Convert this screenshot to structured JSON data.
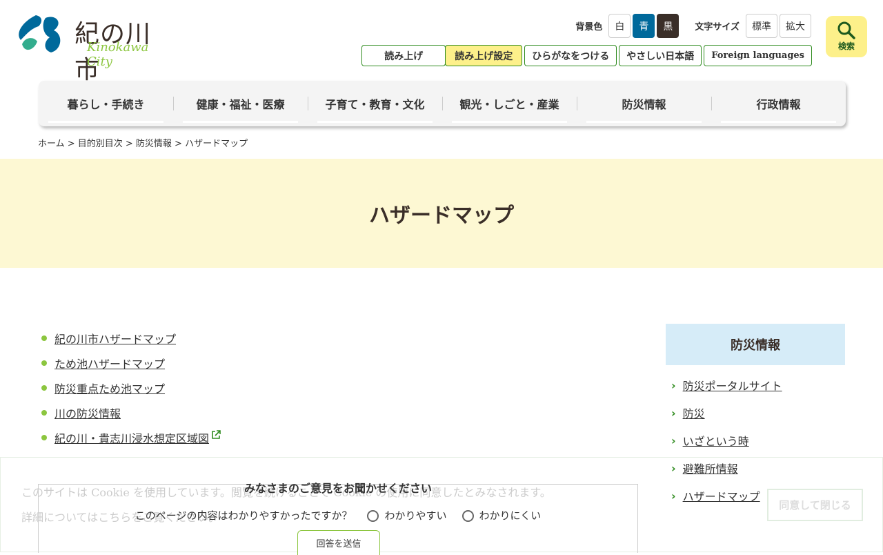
{
  "header": {
    "logo_name": "紀の川市",
    "logo_sub": "Kinokawa City",
    "bg_label": "背景色",
    "bg_options": [
      "白",
      "青",
      "黒"
    ],
    "size_label": "文字サイズ",
    "size_options": [
      "標準",
      "拡大"
    ],
    "tools": [
      "読み上げ",
      "読み上げ設定",
      "ひらがなをつける",
      "やさしい日本語",
      "Foreign languages"
    ],
    "search_label": "検索"
  },
  "nav": [
    "暮らし・手続き",
    "健康・福祉・医療",
    "子育て・教育・文化",
    "観光・しごと・産業",
    "防災情報",
    "行政情報"
  ],
  "breadcrumb": "ホーム > 目的別目次 > 防災情報 > ハザードマップ",
  "page_title": "ハザードマップ",
  "links": [
    "紀の川市ハザードマップ",
    "ため池ハザードマップ",
    "防災重点ため池マップ",
    "川の防災情報",
    "紀の川・貴志川浸水想定区域図"
  ],
  "sidebar": {
    "title": "防災情報",
    "items": [
      "防災ポータルサイト",
      "防災",
      "いざという時",
      "避難所情報",
      "ハザードマップ"
    ]
  },
  "cookie": {
    "line1": "このサイトは Cookie を使用しています。閲覧を続けることで Cookie の使用に同意したとみなされます。",
    "line2": "詳細についてはこちらをご覧ください。",
    "accept": "同意して閉じる"
  },
  "feedback": {
    "title": "みなさまのご意見をお聞かせください",
    "question": "このページの内容はわかりやすかったですか？",
    "opt1": "わかりやすい",
    "opt2": "わかりにくい",
    "submit": "回答を送信"
  }
}
